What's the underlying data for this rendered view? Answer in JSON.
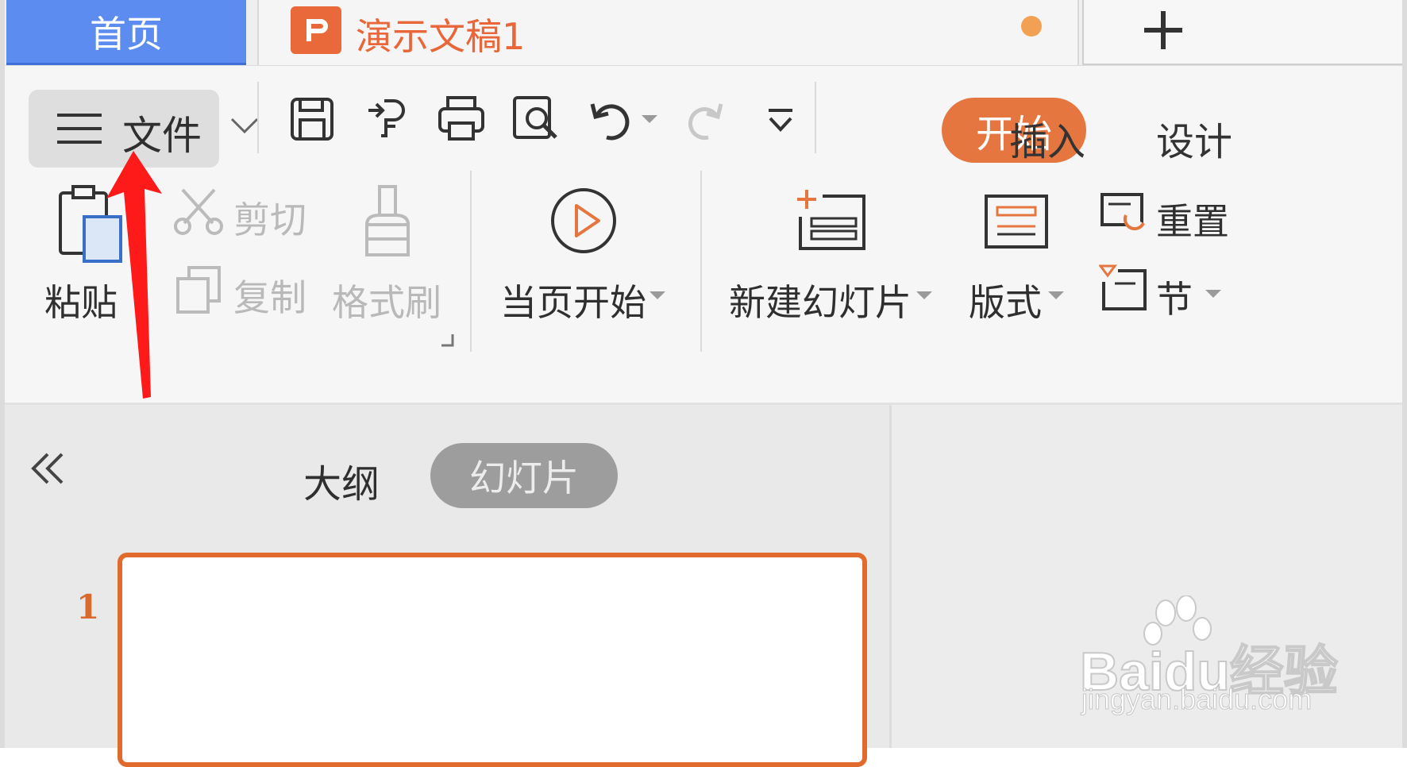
{
  "tabs": {
    "home": "首页",
    "document_title": "演示文稿1",
    "new_tab": "+"
  },
  "menu": {
    "file_label": "文件"
  },
  "ribbon_tabs": {
    "start": "开始",
    "insert": "插入",
    "design": "设计"
  },
  "clipboard": {
    "paste": "粘贴",
    "cut": "剪切",
    "copy": "复制",
    "format_painter": "格式刷"
  },
  "slideshow": {
    "from_current": "当页开始"
  },
  "slides_group": {
    "new_slide": "新建幻灯片",
    "layout": "版式",
    "reset": "重置",
    "section": "节"
  },
  "panel": {
    "outline": "大纲",
    "slides": "幻灯片",
    "slide_number": "1"
  },
  "watermark": {
    "brand": "Baidu经验",
    "url": "jingyan.baidu.com"
  },
  "colors": {
    "accent": "#e57640",
    "home_tab": "#5c8cf0",
    "annotation": "#ff0000"
  }
}
